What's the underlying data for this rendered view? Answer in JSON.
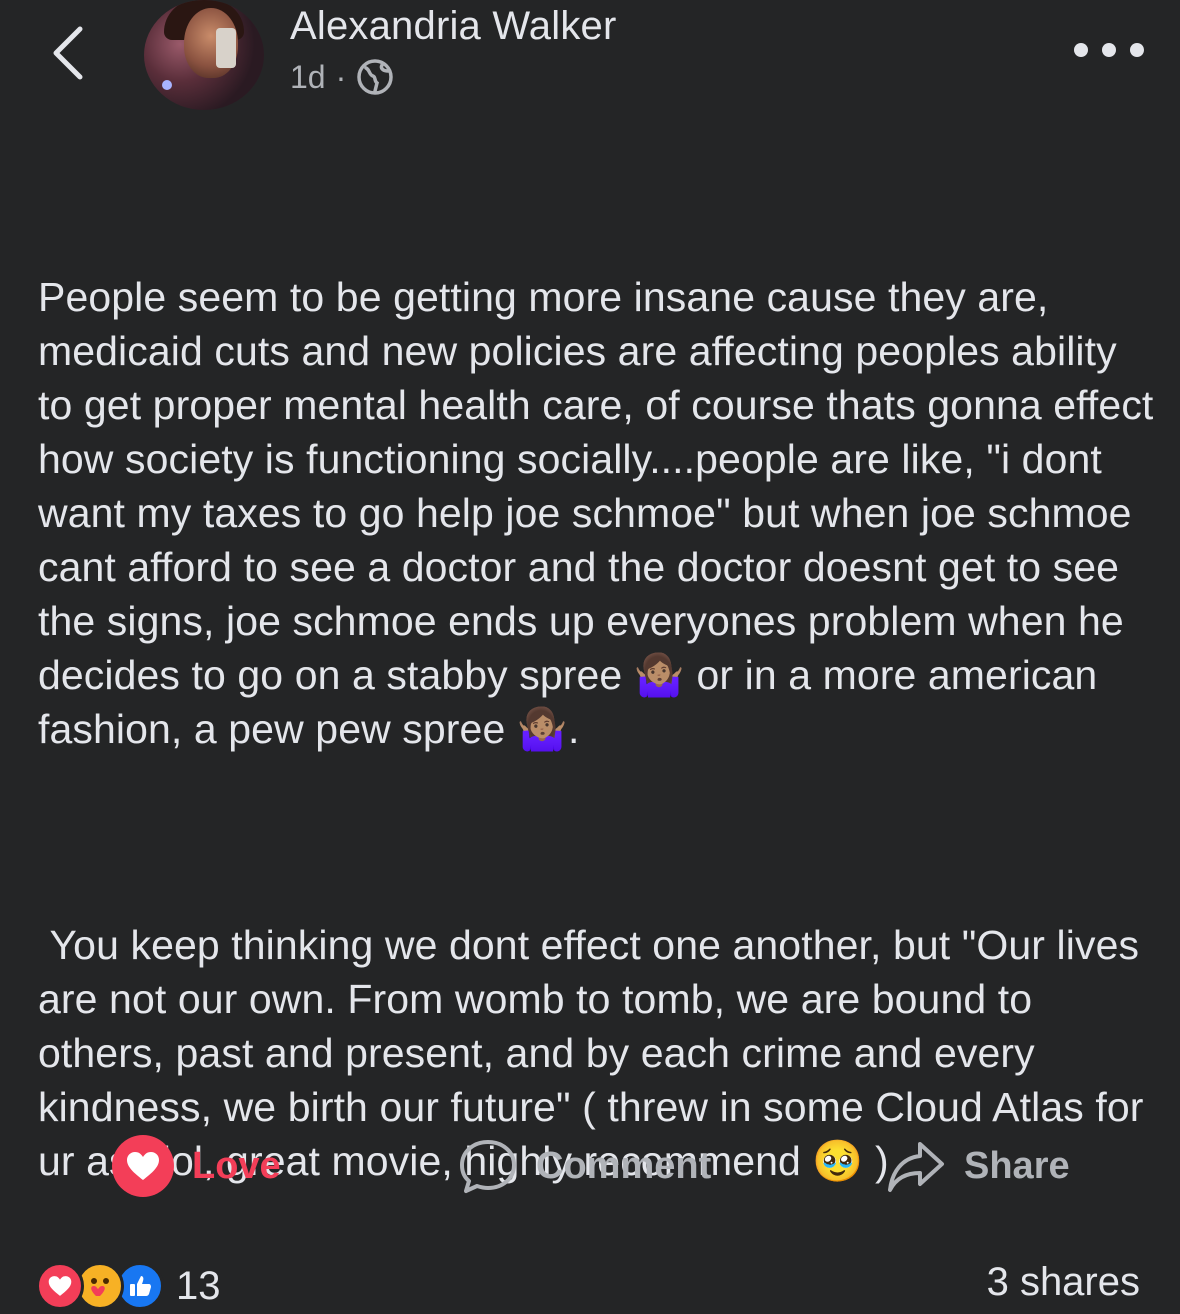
{
  "post": {
    "author": "Alexandria Walker",
    "time": "1d",
    "separator": "·",
    "privacy_icon": "globe-icon",
    "paragraph1": "People seem to be getting more insane cause they are, medicaid cuts and new policies are affecting peoples ability to get proper mental health care, of course thats gonna effect how society is functioning socially....people are like, \"i dont want my taxes to go help joe schmoe\" but when joe schmoe cant afford to see a doctor and the doctor doesnt get to see the signs, joe schmoe ends up everyones problem when he decides to go on a stabby spree 🤷🏽‍♀️ or in a more american fashion, a pew pew spree 🤷🏽‍♀️.",
    "paragraph2": " You keep thinking we dont effect one another, but \"Our lives are not our own. From womb to tomb, we are bound to others, past and present, and by each crime and every kindness, we birth our future\" ( threw in some Cloud Atlas for ur ass lol, great movie, highly recommend 🥹 )"
  },
  "actions": {
    "love_label": "Love",
    "comment_label": "Comment",
    "share_label": "Share"
  },
  "footer": {
    "reaction_icons": [
      "love-icon",
      "care-icon",
      "like-icon"
    ],
    "reaction_count": "13",
    "shares": "3 shares"
  },
  "colors": {
    "background": "#242526",
    "text": "#e4e6eb",
    "secondary": "#b0b3b8",
    "love": "#f33e58",
    "like": "#1877f2"
  }
}
